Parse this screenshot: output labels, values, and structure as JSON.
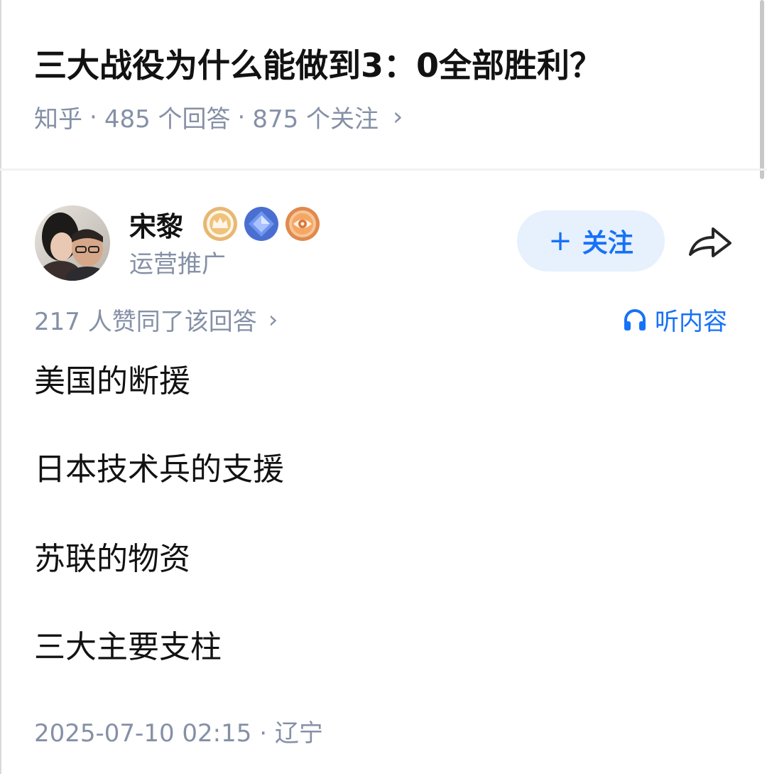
{
  "question": {
    "title": "三大战役为什么能做到3：0全部胜利？",
    "source": "知乎",
    "answers": "485 个回答",
    "followers": "875 个关注",
    "separator": "·",
    "chevron": "›"
  },
  "author": {
    "name": "宋黎",
    "subtitle": "运营推广",
    "badges": [
      "crown-badge-icon",
      "diamond-badge-icon",
      "eye-badge-icon"
    ]
  },
  "actions": {
    "follow_plus": "+",
    "follow_label": "关注",
    "share_icon": "share-arrow-icon"
  },
  "stats": {
    "votes": "217 人赞同了该回答",
    "chevron": "›",
    "listen_label": "听内容",
    "listen_icon": "headphones-icon"
  },
  "content": {
    "paragraphs": [
      "美国的断援",
      "日本技术兵的支援",
      "苏联的物资",
      "三大主要支柱"
    ]
  },
  "footer": {
    "datetime": "2025-07-10 02:15",
    "separator": "·",
    "location": "辽宁"
  },
  "colors": {
    "accent": "#1772f6",
    "follow_bg": "#e7f0fd",
    "meta_gray": "#8590a6",
    "text": "#121212"
  }
}
